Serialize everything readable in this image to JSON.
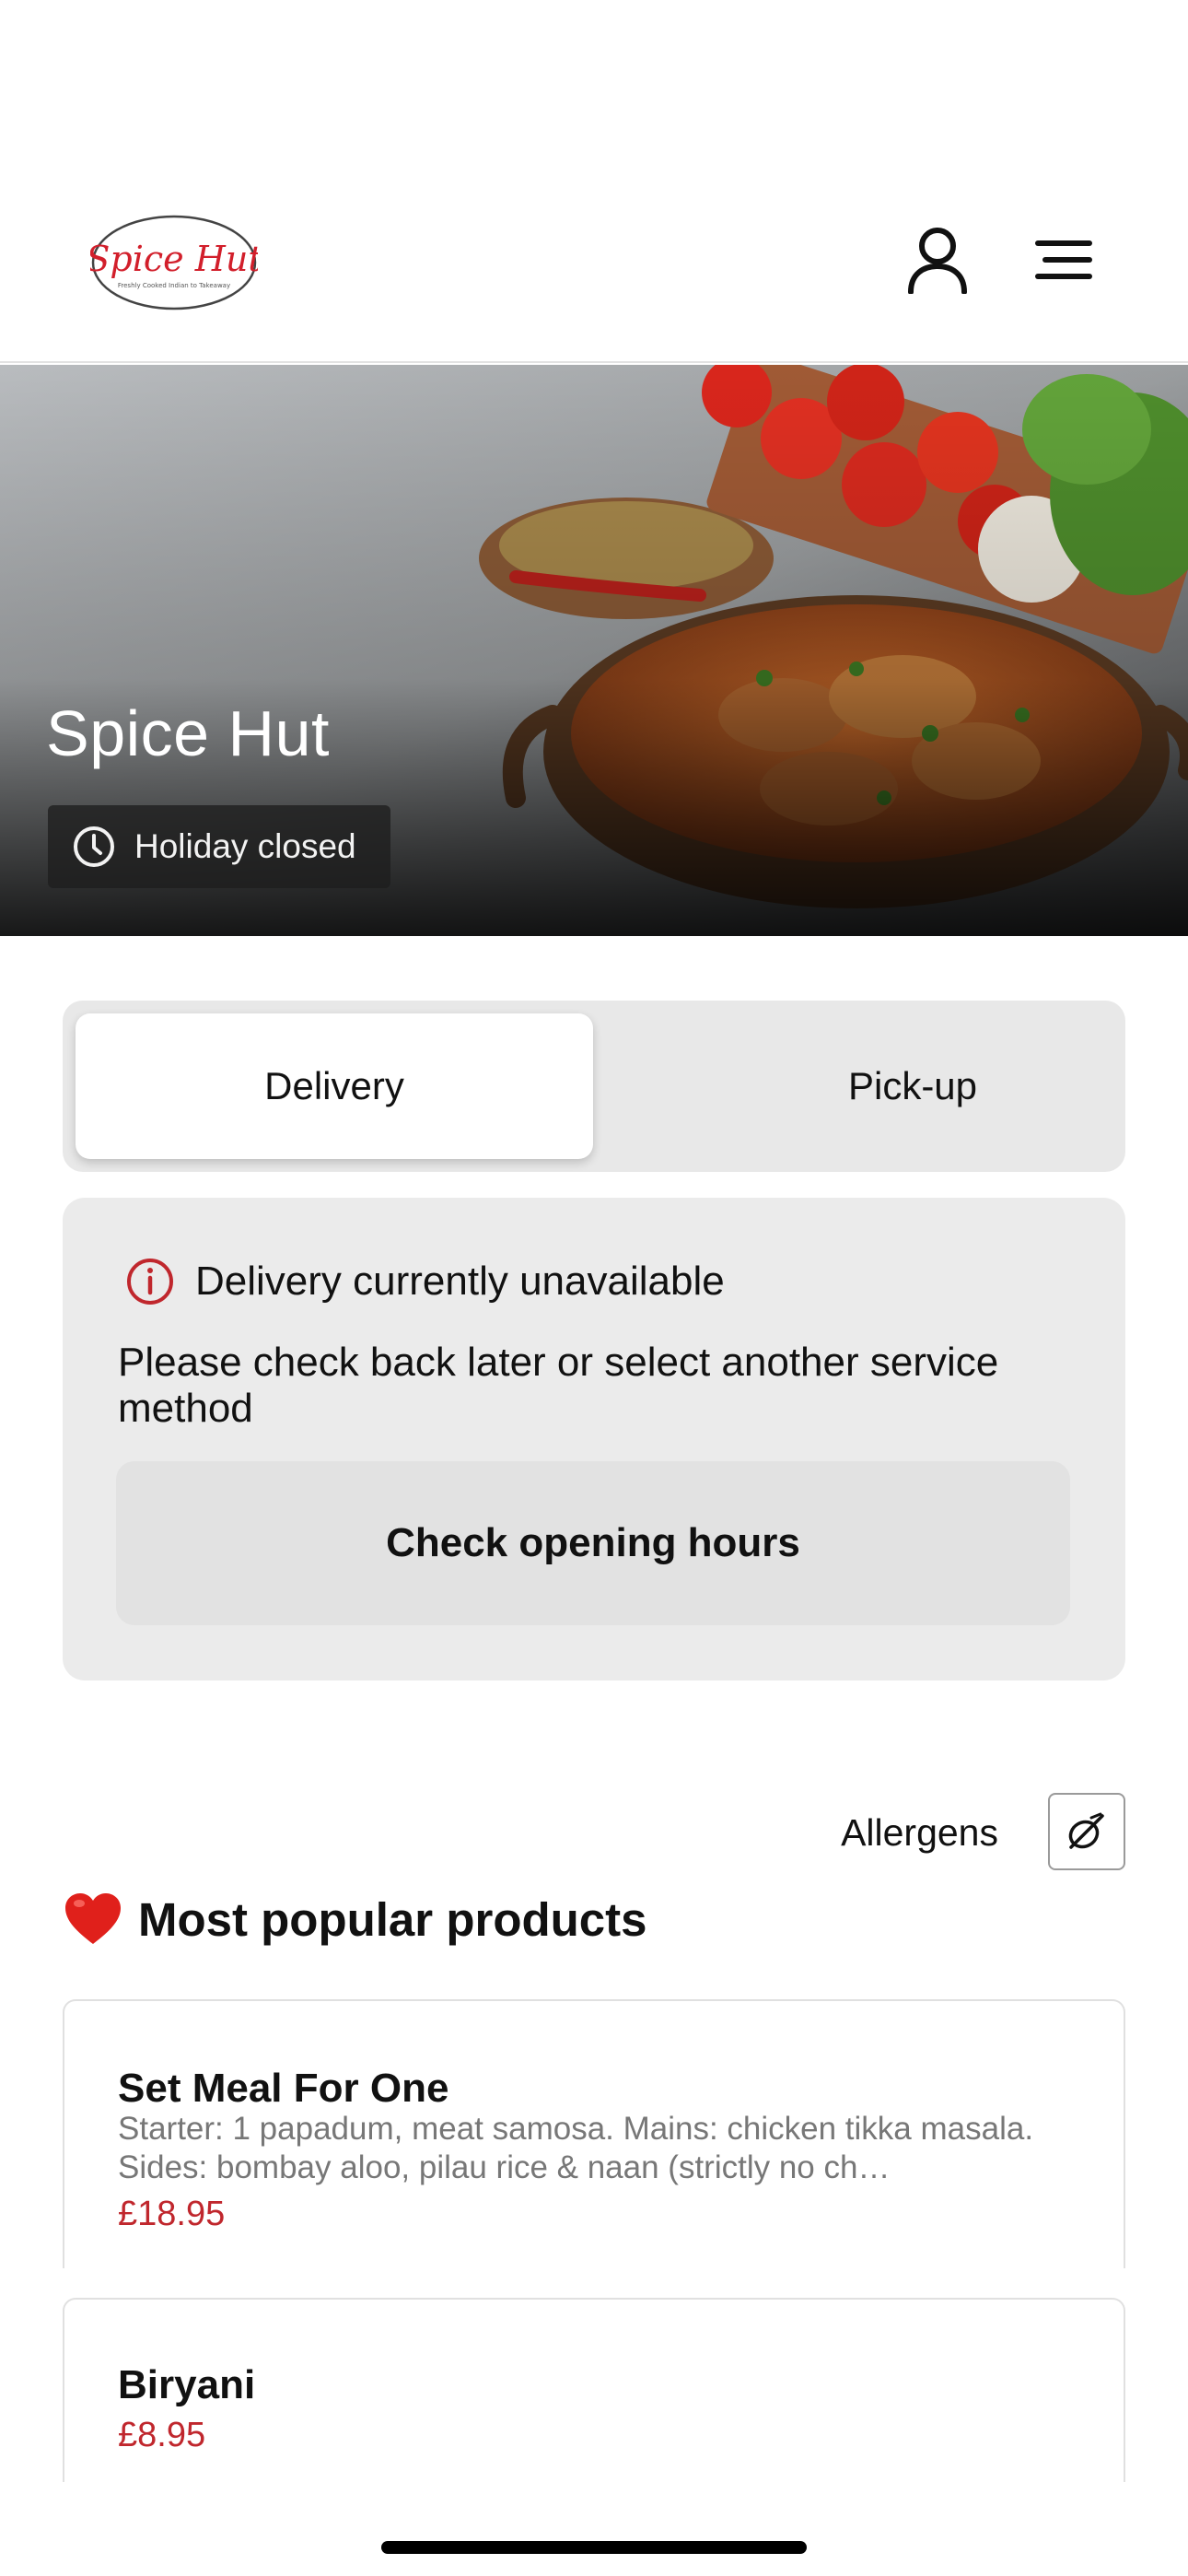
{
  "header": {
    "logo_text": "Spice Hut",
    "logo_tagline": "Freshly Cooked Indian to Takeaway"
  },
  "hero": {
    "title": "Spice Hut",
    "status": "Holiday closed"
  },
  "service_toggle": {
    "tabs": [
      {
        "label": "Delivery",
        "selected": true
      },
      {
        "label": "Pick-up",
        "selected": false
      }
    ]
  },
  "notice": {
    "title": "Delivery currently unavailable",
    "body": "Please check back later or select another service method",
    "button_label": "Check opening hours"
  },
  "allergens": {
    "label": "Allergens"
  },
  "popular": {
    "title": "Most popular products",
    "products": [
      {
        "name": "Set Meal For One",
        "description": "Starter: 1 papadum, meat samosa. Mains: chicken tikka masala. Sides: bombay aloo, pilau rice & naan (strictly no ch…",
        "price": "£18.95"
      },
      {
        "name": "Biryani",
        "price": "£8.95"
      }
    ]
  },
  "colors": {
    "price": "#c0272d",
    "info_icon": "#c0272d",
    "logo_red": "#d21f2b"
  }
}
